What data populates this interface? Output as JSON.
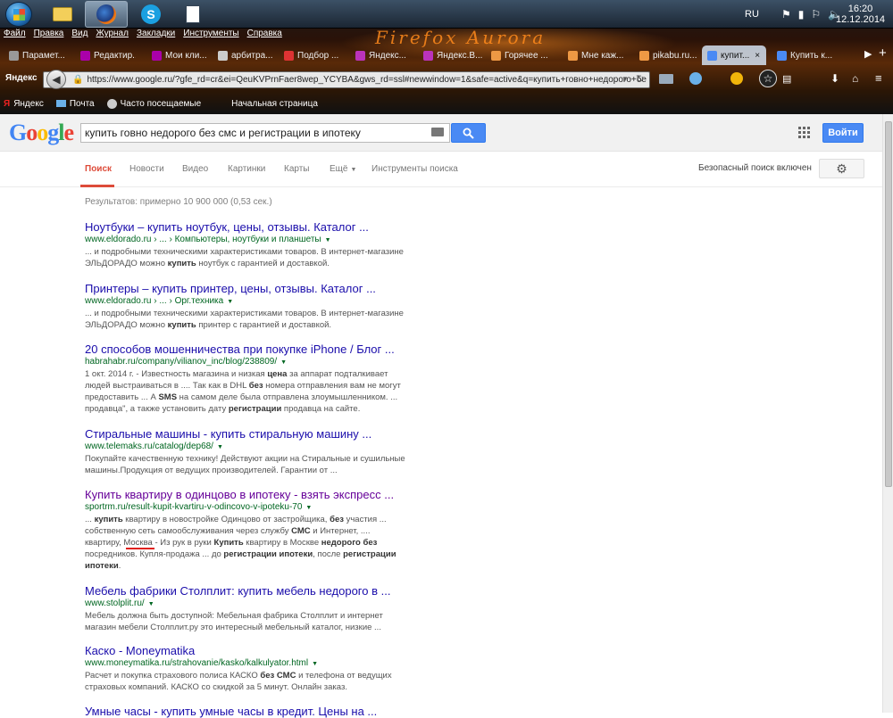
{
  "taskbar": {
    "lang": "RU",
    "time": "16:20",
    "date": "12.12.2014"
  },
  "menu": [
    "Файл",
    "Правка",
    "Вид",
    "Журнал",
    "Закладки",
    "Инструменты",
    "Справка"
  ],
  "tabs": [
    "Парамет...",
    "Редактир...",
    "Мои кли...",
    "арбитра...",
    "Подбор ...",
    "Яндекс...",
    "Яндекс.В...",
    "Горячее ...",
    "Мне каж...",
    "pikabu.ru...",
    "купит...",
    "Купить к..."
  ],
  "brand_overlay": "Firefox Aurora",
  "address": {
    "url": "https://www.google.ru/?gfe_rd=cr&ei=QeuKVPrnFaer8wep_YCYBA&gws_rd=ssl#newwindow=1&safe=active&q=купить+говно+недорого+бе"
  },
  "bookmarks": [
    "Яндекс",
    "Почта",
    "Часто посещаемые",
    "Начальная страница"
  ],
  "google": {
    "query": "купить говно недорого без смс и регистрации в ипотеку",
    "signin": "Войти",
    "nav": [
      "Поиск",
      "Новости",
      "Видео",
      "Картинки",
      "Карты",
      "Ещё",
      "Инструменты поиска"
    ],
    "safe": "Безопасный поиск включен",
    "stats": "Результатов: примерно 10 900 000 (0,53 сек.)"
  },
  "results": [
    {
      "title": "Ноутбуки – купить ноутбук, цены, отзывы. Каталог ...",
      "url": "www.eldorado.ru › ... › Компьютеры, ноутбуки и планшеты"
    },
    {
      "title": "Принтеры – купить принтер, цены, отзывы. Каталог ...",
      "url": "www.eldorado.ru › ... › Орг.техника"
    },
    {
      "title": "20 способов мошенничества при покупке iPhone / Блог ...",
      "url": "habrahabr.ru/company/vilianov_inc/blog/238809/"
    },
    {
      "title": "Стиральные машины - купить стиральную машину ...",
      "url": "www.telemaks.ru/catalog/dep68/"
    },
    {
      "title": "Купить квартиру в одинцово в ипотеку - взять экспресс ...",
      "url": "sportrm.ru/result-kupit-kvartiru-v-odincovo-v-ipoteku-70"
    },
    {
      "title": "Мебель фабрики Столплит: купить мебель недорого в ...",
      "url": "www.stolplit.ru/"
    },
    {
      "title": "Каско - Moneymatika",
      "url": "www.moneymatika.ru/strahovanie/kasko/kalkulyator.html"
    },
    {
      "title": "Умные часы - купить умные часы в кредит. Цены на ...",
      "url": ""
    }
  ]
}
